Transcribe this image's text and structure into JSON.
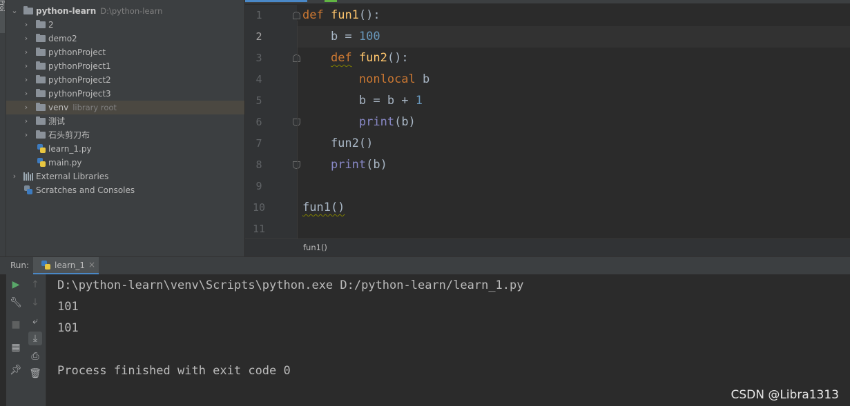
{
  "tool_strip": {
    "tab_label": "Proj"
  },
  "project": {
    "root_name": "python-learn",
    "root_path": "D:\\python-learn",
    "items": [
      {
        "label": "2",
        "type": "folder"
      },
      {
        "label": "demo2",
        "type": "folder"
      },
      {
        "label": "pythonProject",
        "type": "folder"
      },
      {
        "label": "pythonProject1",
        "type": "folder"
      },
      {
        "label": "pythonProject2",
        "type": "folder"
      },
      {
        "label": "pythonProject3",
        "type": "folder"
      },
      {
        "label": "venv",
        "type": "folder",
        "sub": "library root",
        "selected": true
      },
      {
        "label": "测试",
        "type": "folder"
      },
      {
        "label": "石头剪刀布",
        "type": "folder"
      },
      {
        "label": "learn_1.py",
        "type": "python-file"
      },
      {
        "label": "main.py",
        "type": "python-file"
      }
    ],
    "external_libraries": "External Libraries",
    "scratches": "Scratches and Consoles"
  },
  "editor": {
    "line_numbers": [
      "1",
      "2",
      "3",
      "4",
      "5",
      "6",
      "7",
      "8",
      "9",
      "10",
      "11"
    ],
    "current_line": "2",
    "breadcrumb": "fun1()"
  },
  "run": {
    "title": "Run:",
    "tab_label": "learn_1",
    "tab_close": "×",
    "console_lines": [
      "D:\\python-learn\\venv\\Scripts\\python.exe D:/python-learn/learn_1.py",
      "101",
      "101",
      "",
      "Process finished with exit code 0"
    ]
  },
  "watermark": "CSDN @Libra1313",
  "colors": {
    "keyword": "#cc7832",
    "function": "#ffc66d",
    "number": "#6897bb",
    "builtin": "#8888c6",
    "text": "#a9b7c6"
  },
  "icons": {
    "run": "play-icon",
    "rerun": "wrench-icon",
    "stop": "stop-icon",
    "layout": "layout-icon",
    "pin": "pin-icon",
    "up": "arrow-up-icon",
    "down": "arrow-down-icon",
    "wrap": "soft-wrap-icon",
    "scroll": "scroll-to-end-icon",
    "print": "print-icon",
    "trash": "trash-icon"
  }
}
